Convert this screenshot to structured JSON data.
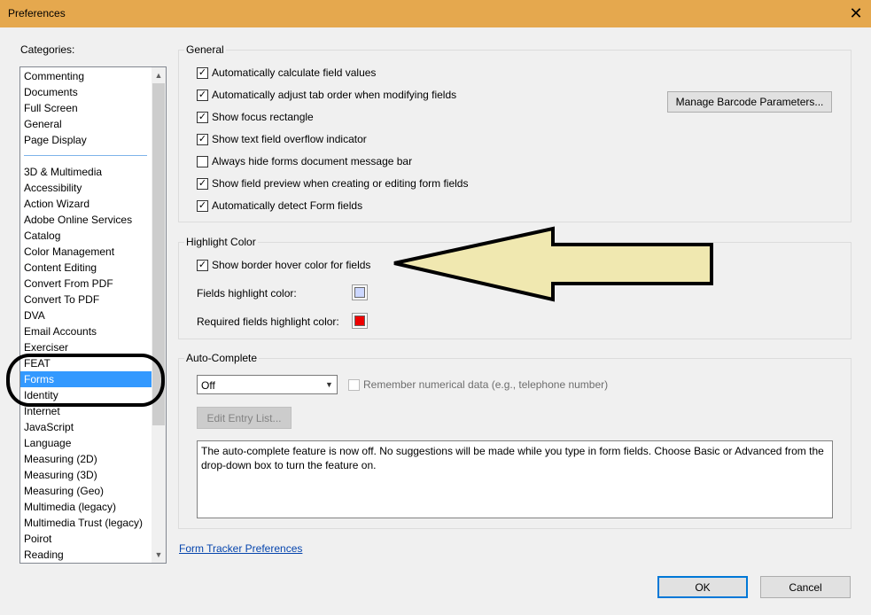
{
  "window": {
    "title": "Preferences",
    "close_glyph": "✕"
  },
  "categories": {
    "label": "Categories:",
    "group_top": [
      "Commenting",
      "Documents",
      "Full Screen",
      "General",
      "Page Display"
    ],
    "group_bottom": [
      "3D & Multimedia",
      "Accessibility",
      "Action Wizard",
      "Adobe Online Services",
      "Catalog",
      "Color Management",
      "Content Editing",
      "Convert From PDF",
      "Convert To PDF",
      "DVA",
      "Email Accounts",
      "Exerciser",
      "FEAT",
      "Forms",
      "Identity",
      "Internet",
      "JavaScript",
      "Language",
      "Measuring (2D)",
      "Measuring (3D)",
      "Measuring (Geo)",
      "Multimedia (legacy)",
      "Multimedia Trust (legacy)",
      "Poirot",
      "Reading"
    ],
    "selected": "Forms"
  },
  "general": {
    "title": "General",
    "options": [
      {
        "label": "Automatically calculate field values",
        "checked": true
      },
      {
        "label": "Automatically adjust tab order when modifying fields",
        "checked": true
      },
      {
        "label": "Show focus rectangle",
        "checked": true
      },
      {
        "label": "Show text field overflow indicator",
        "checked": true
      },
      {
        "label": "Always hide forms document message bar",
        "checked": false
      },
      {
        "label": "Show field preview when creating or editing form fields",
        "checked": true
      },
      {
        "label": "Automatically detect Form fields",
        "checked": true
      }
    ],
    "barcode_button": "Manage Barcode Parameters..."
  },
  "highlight": {
    "title": "Highlight Color",
    "hover_label": "Show border hover color for fields",
    "hover_checked": true,
    "fields_label": "Fields highlight color:",
    "fields_color": "#ccd7ff",
    "required_label": "Required fields highlight color:",
    "required_color": "#ee0000"
  },
  "autocomplete": {
    "title": "Auto-Complete",
    "mode": "Off",
    "remember_label": "Remember numerical data (e.g., telephone number)",
    "remember_checked": false,
    "edit_button": "Edit Entry List...",
    "info": "The auto-complete feature is now off. No suggestions will be made while you type in form fields. Choose Basic or Advanced from the drop-down box to turn the feature on."
  },
  "links": {
    "tracker": "Form Tracker Preferences"
  },
  "buttons": {
    "ok": "OK",
    "cancel": "Cancel"
  },
  "colors": {
    "titlebar": "#e5a84e",
    "selection": "#3399ff",
    "arrow_fill": "#f0e8b0"
  }
}
